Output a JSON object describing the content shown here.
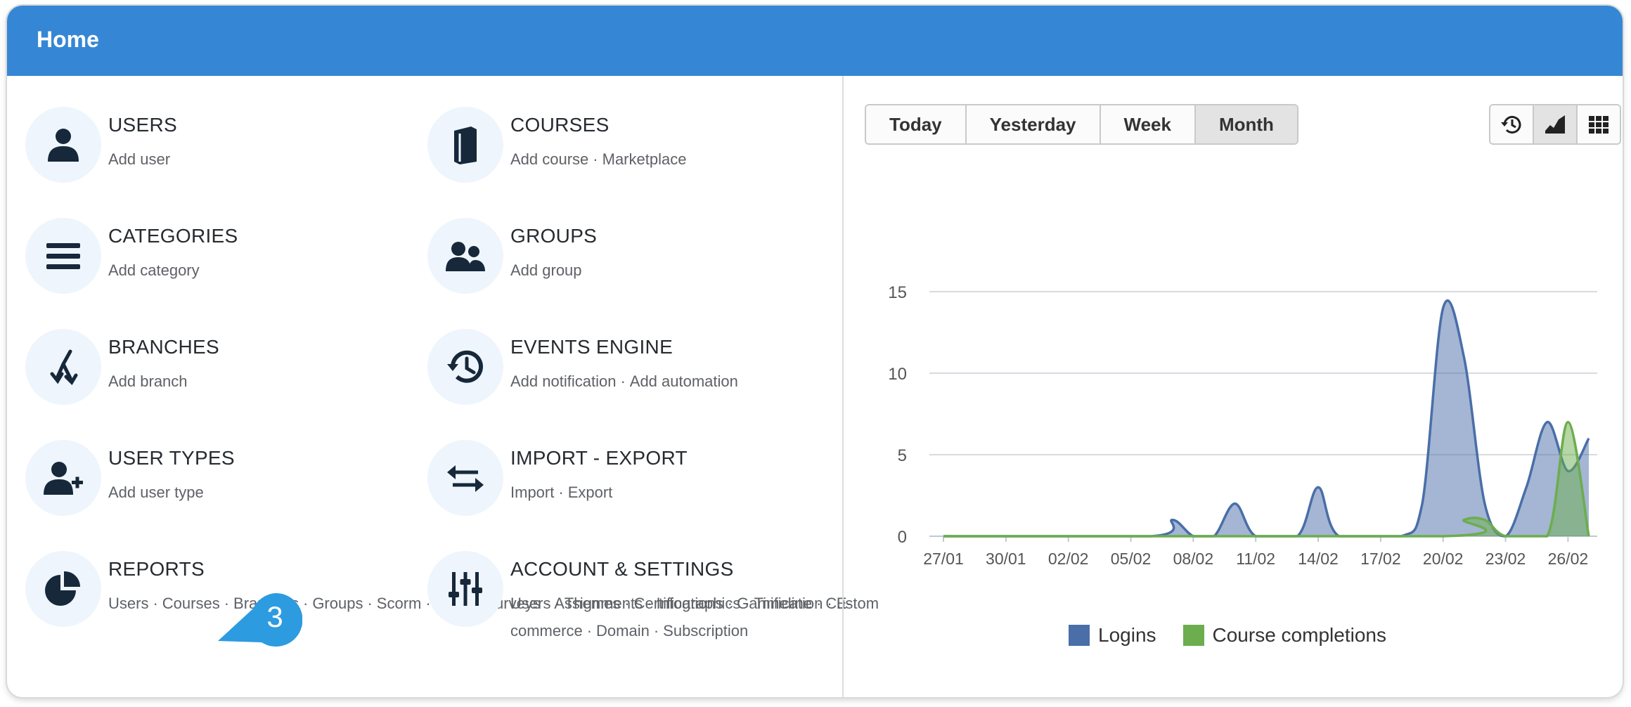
{
  "header": {
    "title": "Home"
  },
  "tiles": {
    "users": {
      "title": "USERS",
      "links": [
        "Add user"
      ]
    },
    "courses": {
      "title": "COURSES",
      "links": [
        "Add course",
        "Marketplace"
      ]
    },
    "categories": {
      "title": "CATEGORIES",
      "links": [
        "Add category"
      ]
    },
    "groups": {
      "title": "GROUPS",
      "links": [
        "Add group"
      ]
    },
    "branches": {
      "title": "BRANCHES",
      "links": [
        "Add branch"
      ]
    },
    "events": {
      "title": "EVENTS ENGINE",
      "links": [
        "Add notification",
        "Add automation"
      ]
    },
    "usertypes": {
      "title": "USER TYPES",
      "links": [
        "Add user type"
      ]
    },
    "importexport": {
      "title": "IMPORT - EXPORT",
      "links": [
        "Import",
        "Export"
      ]
    },
    "reports": {
      "title": "REPORTS",
      "links": [
        "Users",
        "Courses",
        "Branches",
        "Groups",
        "Scorm",
        "Tests",
        "Surveys",
        "Assignments",
        "Infographics",
        "Timeline",
        "Custom"
      ]
    },
    "account": {
      "title": "ACCOUNT & SETTINGS",
      "links": [
        "Users",
        "Themes",
        "Certifications",
        "Gamification",
        "E-commerce",
        "Domain",
        "Subscription"
      ]
    }
  },
  "callout": {
    "number": "3",
    "color": "#2d9be0"
  },
  "range_buttons": {
    "today": "Today",
    "yesterday": "Yesterday",
    "week": "Week",
    "month": "Month",
    "active": "Month"
  },
  "view_buttons": {
    "history": "history-icon",
    "area": "area-chart-icon",
    "grid": "grid-icon",
    "active": "area"
  },
  "colors": {
    "header": "#3587d5",
    "icon": "#16283a",
    "logins": "#4a6ea8",
    "completions": "#6cad4e"
  },
  "chart_data": {
    "type": "area",
    "x_tick_labels": [
      "27/01",
      "30/01",
      "02/02",
      "05/02",
      "08/02",
      "11/02",
      "14/02",
      "17/02",
      "20/02",
      "23/02",
      "26/02"
    ],
    "x_start": "27/01",
    "x_end": "27/02",
    "ylim": [
      0,
      15
    ],
    "y_ticks": [
      0,
      5,
      10,
      15
    ],
    "grid": true,
    "legend_position": "bottom-center",
    "series": [
      {
        "name": "Logins",
        "points": [
          [
            "27/01",
            0
          ],
          [
            "06/02",
            0
          ],
          [
            "07/02",
            1
          ],
          [
            "08/02",
            0
          ],
          [
            "09/02",
            0
          ],
          [
            "10/02",
            2
          ],
          [
            "11/02",
            0
          ],
          [
            "13/02",
            0
          ],
          [
            "14/02",
            3
          ],
          [
            "15/02",
            0
          ],
          [
            "18/02",
            0
          ],
          [
            "19/02",
            2
          ],
          [
            "20/02",
            14
          ],
          [
            "21/02",
            11
          ],
          [
            "22/02",
            2
          ],
          [
            "23/02",
            0
          ],
          [
            "24/02",
            3
          ],
          [
            "25/02",
            7
          ],
          [
            "26/02",
            4
          ],
          [
            "27/02",
            6
          ]
        ]
      },
      {
        "name": "Course completions",
        "points": [
          [
            "27/01",
            0
          ],
          [
            "20/02",
            0
          ],
          [
            "21/02",
            1
          ],
          [
            "22/02",
            1
          ],
          [
            "23/02",
            0
          ],
          [
            "25/02",
            0
          ],
          [
            "26/02",
            7
          ],
          [
            "27/02",
            0
          ]
        ]
      }
    ]
  }
}
